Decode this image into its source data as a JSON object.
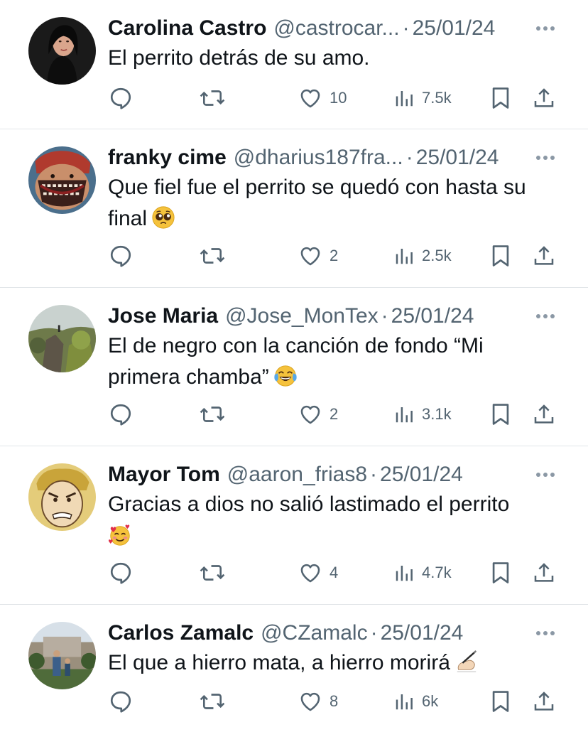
{
  "tweets": [
    {
      "name": "Carolina Castro",
      "handle": "@castrocar...",
      "separator": "·",
      "date": "25/01/24",
      "text": "El perrito detrás de su amo.",
      "emoji": "",
      "likes": "10",
      "views": "7.5k"
    },
    {
      "name": "franky cime",
      "handle": "@dharius187fra...",
      "separator": "·",
      "date": "25/01/24",
      "text": "Que fiel fue el perrito se quedó con hasta su final",
      "emoji": "pleading-face-emoji",
      "likes": "2",
      "views": "2.5k"
    },
    {
      "name": "Jose Maria",
      "handle": "@Jose_MonTex",
      "separator": "·",
      "date": "25/01/24",
      "text": "El de negro con la canción de fondo “Mi primera chamba”",
      "emoji": "tears-of-joy-emoji",
      "likes": "2",
      "views": "3.1k"
    },
    {
      "name": "Mayor Tom",
      "handle": "@aaron_frias8",
      "separator": "·",
      "date": "25/01/24",
      "text": "Gracias a dios no salió lastimado el perrito",
      "emoji": "smiling-face-with-hearts-emoji",
      "likes": "4",
      "views": "4.7k"
    },
    {
      "name": "Carlos Zamalc",
      "handle": "@CZamalc",
      "separator": "·",
      "date": "25/01/24",
      "text": "El que a hierro mata, a hierro morirá",
      "emoji": "writing-hand-emoji",
      "likes": "8",
      "views": "6k"
    }
  ],
  "icons": {
    "reply": "reply-icon",
    "retweet": "retweet-icon",
    "like": "heart-icon",
    "views": "views-icon",
    "bookmark": "bookmark-icon",
    "share": "share-icon",
    "more": "more-icon"
  },
  "colors": {
    "text": "#0f1419",
    "secondary": "#536471",
    "divider": "#e1e5e8"
  }
}
